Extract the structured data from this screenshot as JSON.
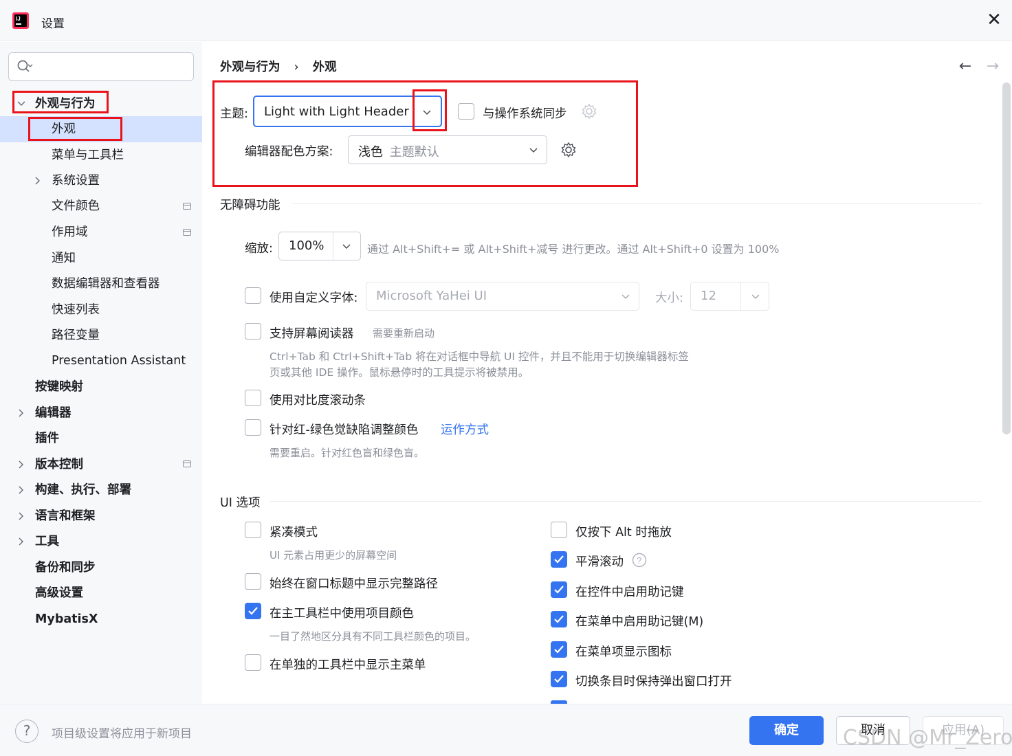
{
  "window": {
    "title": "设置",
    "close_icon": "close-icon"
  },
  "search": {
    "placeholder": ""
  },
  "sidebar": {
    "items": [
      {
        "label": "外观与行为",
        "bold": true
      },
      {
        "label": "外观"
      },
      {
        "label": "菜单与工具栏"
      },
      {
        "label": "系统设置"
      },
      {
        "label": "文件颜色"
      },
      {
        "label": "作用域"
      },
      {
        "label": "通知"
      },
      {
        "label": "数据编辑器和查看器"
      },
      {
        "label": "快速列表"
      },
      {
        "label": "路径变量"
      },
      {
        "label": "Presentation Assistant"
      },
      {
        "label": "按键映射",
        "bold": true
      },
      {
        "label": "编辑器",
        "bold": true
      },
      {
        "label": "插件",
        "bold": true
      },
      {
        "label": "版本控制",
        "bold": true
      },
      {
        "label": "构建、执行、部署",
        "bold": true
      },
      {
        "label": "语言和框架",
        "bold": true
      },
      {
        "label": "工具",
        "bold": true
      },
      {
        "label": "备份和同步",
        "bold": true
      },
      {
        "label": "高级设置",
        "bold": true
      },
      {
        "label": "MybatisX",
        "bold": true
      }
    ]
  },
  "breadcrumb": {
    "parent": "外观与行为",
    "separator": "›",
    "current": "外观"
  },
  "nav": {
    "back": "←",
    "forward": "→"
  },
  "theme": {
    "label": "主题:",
    "value": "Light with Light Header",
    "sync_label": "与操作系统同步",
    "sync_checked": false
  },
  "editor_scheme": {
    "label": "编辑器配色方案:",
    "value": "浅色",
    "value_hint": "主题默认"
  },
  "accessibility": {
    "title": "无障碍功能",
    "zoom_label": "缩放:",
    "zoom_value": "100%",
    "zoom_hint": "通过 Alt+Shift+= 或 Alt+Shift+减号 进行更改。通过 Alt+Shift+0 设置为 100%",
    "custom_font_label": "使用自定义字体:",
    "font_value": "Microsoft YaHei UI",
    "size_label": "大小:",
    "size_value": "12",
    "screen_reader_label": "支持屏幕阅读器",
    "screen_reader_hint": "需要重新启动",
    "screen_reader_desc_1": "Ctrl+Tab 和 Ctrl+Shift+Tab 将在对话框中导航 UI 控件，并且不能用于切换编辑器标签",
    "screen_reader_desc_2": "页或其他 IDE 操作。鼠标悬停时的工具提示将被禁用。",
    "contrast_scroll_label": "使用对比度滚动条",
    "color_deficiency_label": "针对红-绿色觉缺陷调整颜色",
    "color_deficiency_link": "运作方式",
    "color_deficiency_hint": "需要重启。针对红色盲和绿色盲。"
  },
  "ui_options": {
    "title": "UI 选项",
    "left": [
      {
        "label": "紧凑模式",
        "checked": false,
        "hint": "UI 元素占用更少的屏幕空间"
      },
      {
        "label": "始终在窗口标题中显示完整路径",
        "checked": false
      },
      {
        "label": "在主工具栏中使用项目颜色",
        "checked": true,
        "hint": "一目了然地区分具有不同工具栏颜色的项目。"
      },
      {
        "label": "在单独的工具栏中显示主菜单",
        "checked": false
      }
    ],
    "right": [
      {
        "label": "仅按下 Alt 时拖放",
        "checked": false
      },
      {
        "label": "平滑滚动",
        "checked": true
      },
      {
        "label": "在控件中启用助记键",
        "checked": true
      },
      {
        "label": "在菜单中启用助记键(M)",
        "checked": true
      },
      {
        "label": "在菜单项显示图标",
        "checked": true
      },
      {
        "label": "切换条目时保持弹出窗口打开",
        "checked": true
      }
    ]
  },
  "footer": {
    "help": "?",
    "hint": "项目级设置将应用于新项目",
    "ok": "确定",
    "cancel": "取消",
    "apply": "应用(A)",
    "watermark": "CSDN @Mr_Zerone"
  },
  "colors": {
    "accent": "#3574f0",
    "highlight": "#e8131b",
    "selection": "#d4e2ff"
  }
}
